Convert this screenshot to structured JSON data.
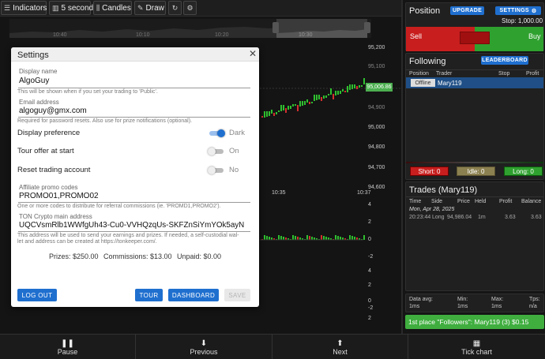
{
  "toolbar": {
    "indicators": "Indicators",
    "interval": "5 second",
    "chart_style": "Candles",
    "draw": "Draw"
  },
  "chart": {
    "nav_ticks": [
      "10:10",
      "10:30"
    ],
    "nav_ticks_faint": [
      "10:40",
      "10:20"
    ],
    "price_ticks": [
      "95,200",
      "95,000",
      "94,800",
      "94,700",
      "94,600"
    ],
    "price_ticks_faint": [
      "95,100",
      "94,900"
    ],
    "current_price": "95,006.86",
    "time_ticks": [
      "10:35",
      "10:37"
    ],
    "volume_ticks": [
      "4",
      "2",
      "0",
      "-2",
      "4",
      "2",
      "0",
      "-2",
      "2"
    ]
  },
  "settings": {
    "title": "Settings",
    "display_name_label": "Display name",
    "display_name": "AlgoGuy",
    "display_name_hint": "This will be shown when if you set your trading to 'Public'.",
    "email_label": "Email address",
    "email": "algoguy@gmx.com",
    "email_hint": "Required for password resets. Also use for prize notifications (optional).",
    "display_pref_label": "Display preference",
    "display_pref_value": "Dark",
    "tour_label": "Tour offer at start",
    "tour_value": "On",
    "reset_label": "Reset trading account",
    "reset_value": "No",
    "promo_label": "Affiliate promo codes",
    "promo_value": "PROMO01,PROMO02",
    "promo_hint": "One or more codes to distribute for referral commissions (ie. 'PROMD1,PROMO2').",
    "ton_label": "TON Crypto main address",
    "ton_value": "UQCVsmRlb1WWfgUh43-Cu0-VVHQzqUs-SKFZnSiYmYOk5ayN",
    "ton_hint_1": "This address will be used to send your earnings and prizes. If needed, a self-custodial wal-",
    "ton_hint_2": "let and address can be created at https://tonkeeper.com/.",
    "prizes": "Prizes: $250.00",
    "commissions": "Commissions: $13.00",
    "unpaid": "Unpaid: $0.00",
    "logout": "LOG OUT",
    "tour": "TOUR",
    "dashboard": "DASHBOARD",
    "save": "SAVE"
  },
  "panel": {
    "position_title": "Position",
    "upgrade": "UPGRADE",
    "settings_btn": "SETTINGS",
    "stop": "Stop: 1,000.00",
    "sell": "Sell",
    "buy": "Buy",
    "following_title": "Following",
    "leaderboard": "LEADERBOARD",
    "following_cols": [
      "Position",
      "Trader",
      "Stop",
      "Profit"
    ],
    "follow_status": "Offline",
    "follow_trader": "Mary119",
    "short": "Short: 0",
    "idle": "Idle: 0",
    "long": "Long: 0",
    "trades_title": "Trades (Mary119)",
    "trades_cols": [
      "Time",
      "Side",
      "Price",
      "Held",
      "Profit",
      "Balance"
    ],
    "trade_date": "Mon, Apr 28, 2025",
    "trade_row": [
      "20:23:44",
      "Long",
      "94,986.04",
      "1m",
      "3.63",
      "3.63"
    ],
    "stats": [
      {
        "label": "Data avg:",
        "value": "1ms"
      },
      {
        "label": "Min:",
        "value": "1ms"
      },
      {
        "label": "Max:",
        "value": "1ms"
      },
      {
        "label": "Tps:",
        "value": "n/a"
      }
    ],
    "prize_banner": "1st place \"Followers\": Mary119 (3) $0.15"
  },
  "bottom": {
    "pause": "Pause",
    "previous": "Previous",
    "next": "Next",
    "tick_chart": "Tick chart"
  },
  "colors": {
    "accent": "#1f6fcf",
    "sell": "#c81e1e",
    "buy": "#2fa12f",
    "price_tag": "#4caf50",
    "banner": "#3fae3f"
  }
}
